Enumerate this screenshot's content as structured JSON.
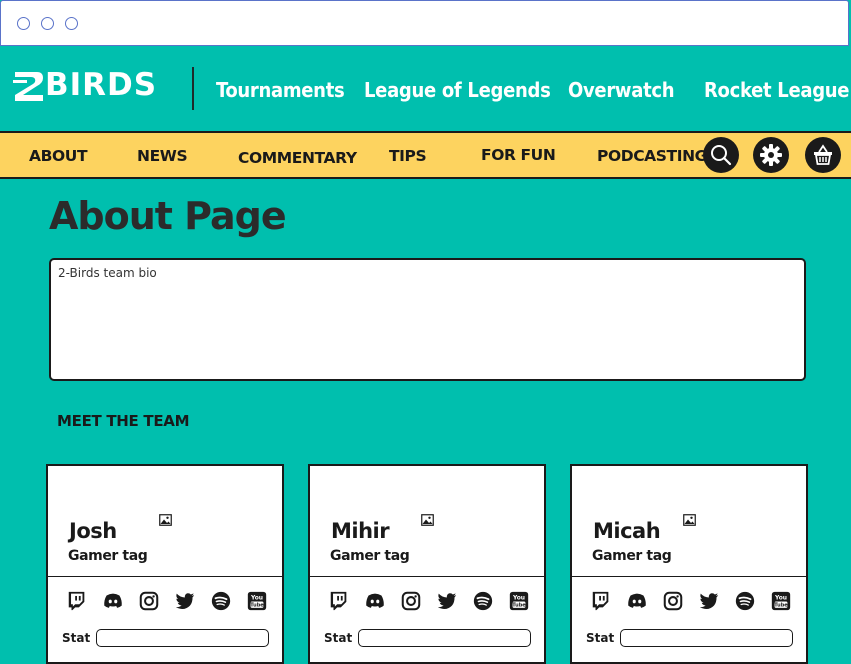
{
  "window": {
    "controls": [
      "close",
      "minimize",
      "maximize"
    ]
  },
  "brand": {
    "logo_text": "BIRDS",
    "logo_prefix": "2",
    "color": "#ffffff"
  },
  "top_nav": [
    {
      "label": "Tournaments"
    },
    {
      "label": "League of Legends"
    },
    {
      "label": "Overwatch"
    },
    {
      "label": "Rocket League"
    }
  ],
  "sub_nav": [
    {
      "label": "ABOUT"
    },
    {
      "label": "NEWS"
    },
    {
      "label": "COMMENTARY"
    },
    {
      "label": "TIPS"
    },
    {
      "label": "FOR FUN"
    },
    {
      "label": "PODCASTING"
    }
  ],
  "actions": {
    "icons": [
      "search-icon",
      "gear-icon",
      "basket-icon"
    ]
  },
  "page": {
    "title": "About Page",
    "bio": "2-Birds team bio",
    "team_heading": "MEET THE TEAM"
  },
  "team": [
    {
      "name": "Josh",
      "gamer_tag": "Gamer tag",
      "stat_label": "Stat",
      "stat_value": ""
    },
    {
      "name": "Mihir",
      "gamer_tag": "Gamer tag",
      "stat_label": "Stat",
      "stat_value": ""
    },
    {
      "name": "Micah",
      "gamer_tag": "Gamer tag",
      "stat_label": "Stat",
      "stat_value": ""
    }
  ],
  "social_icons": [
    "twitch-icon",
    "discord-icon",
    "instagram-icon",
    "twitter-icon",
    "spotify-icon",
    "youtube-icon"
  ],
  "colors": {
    "background": "#00bfae",
    "subnav": "#fdd35f",
    "dark": "#1a1a1a",
    "window_border": "#5a73c9"
  }
}
